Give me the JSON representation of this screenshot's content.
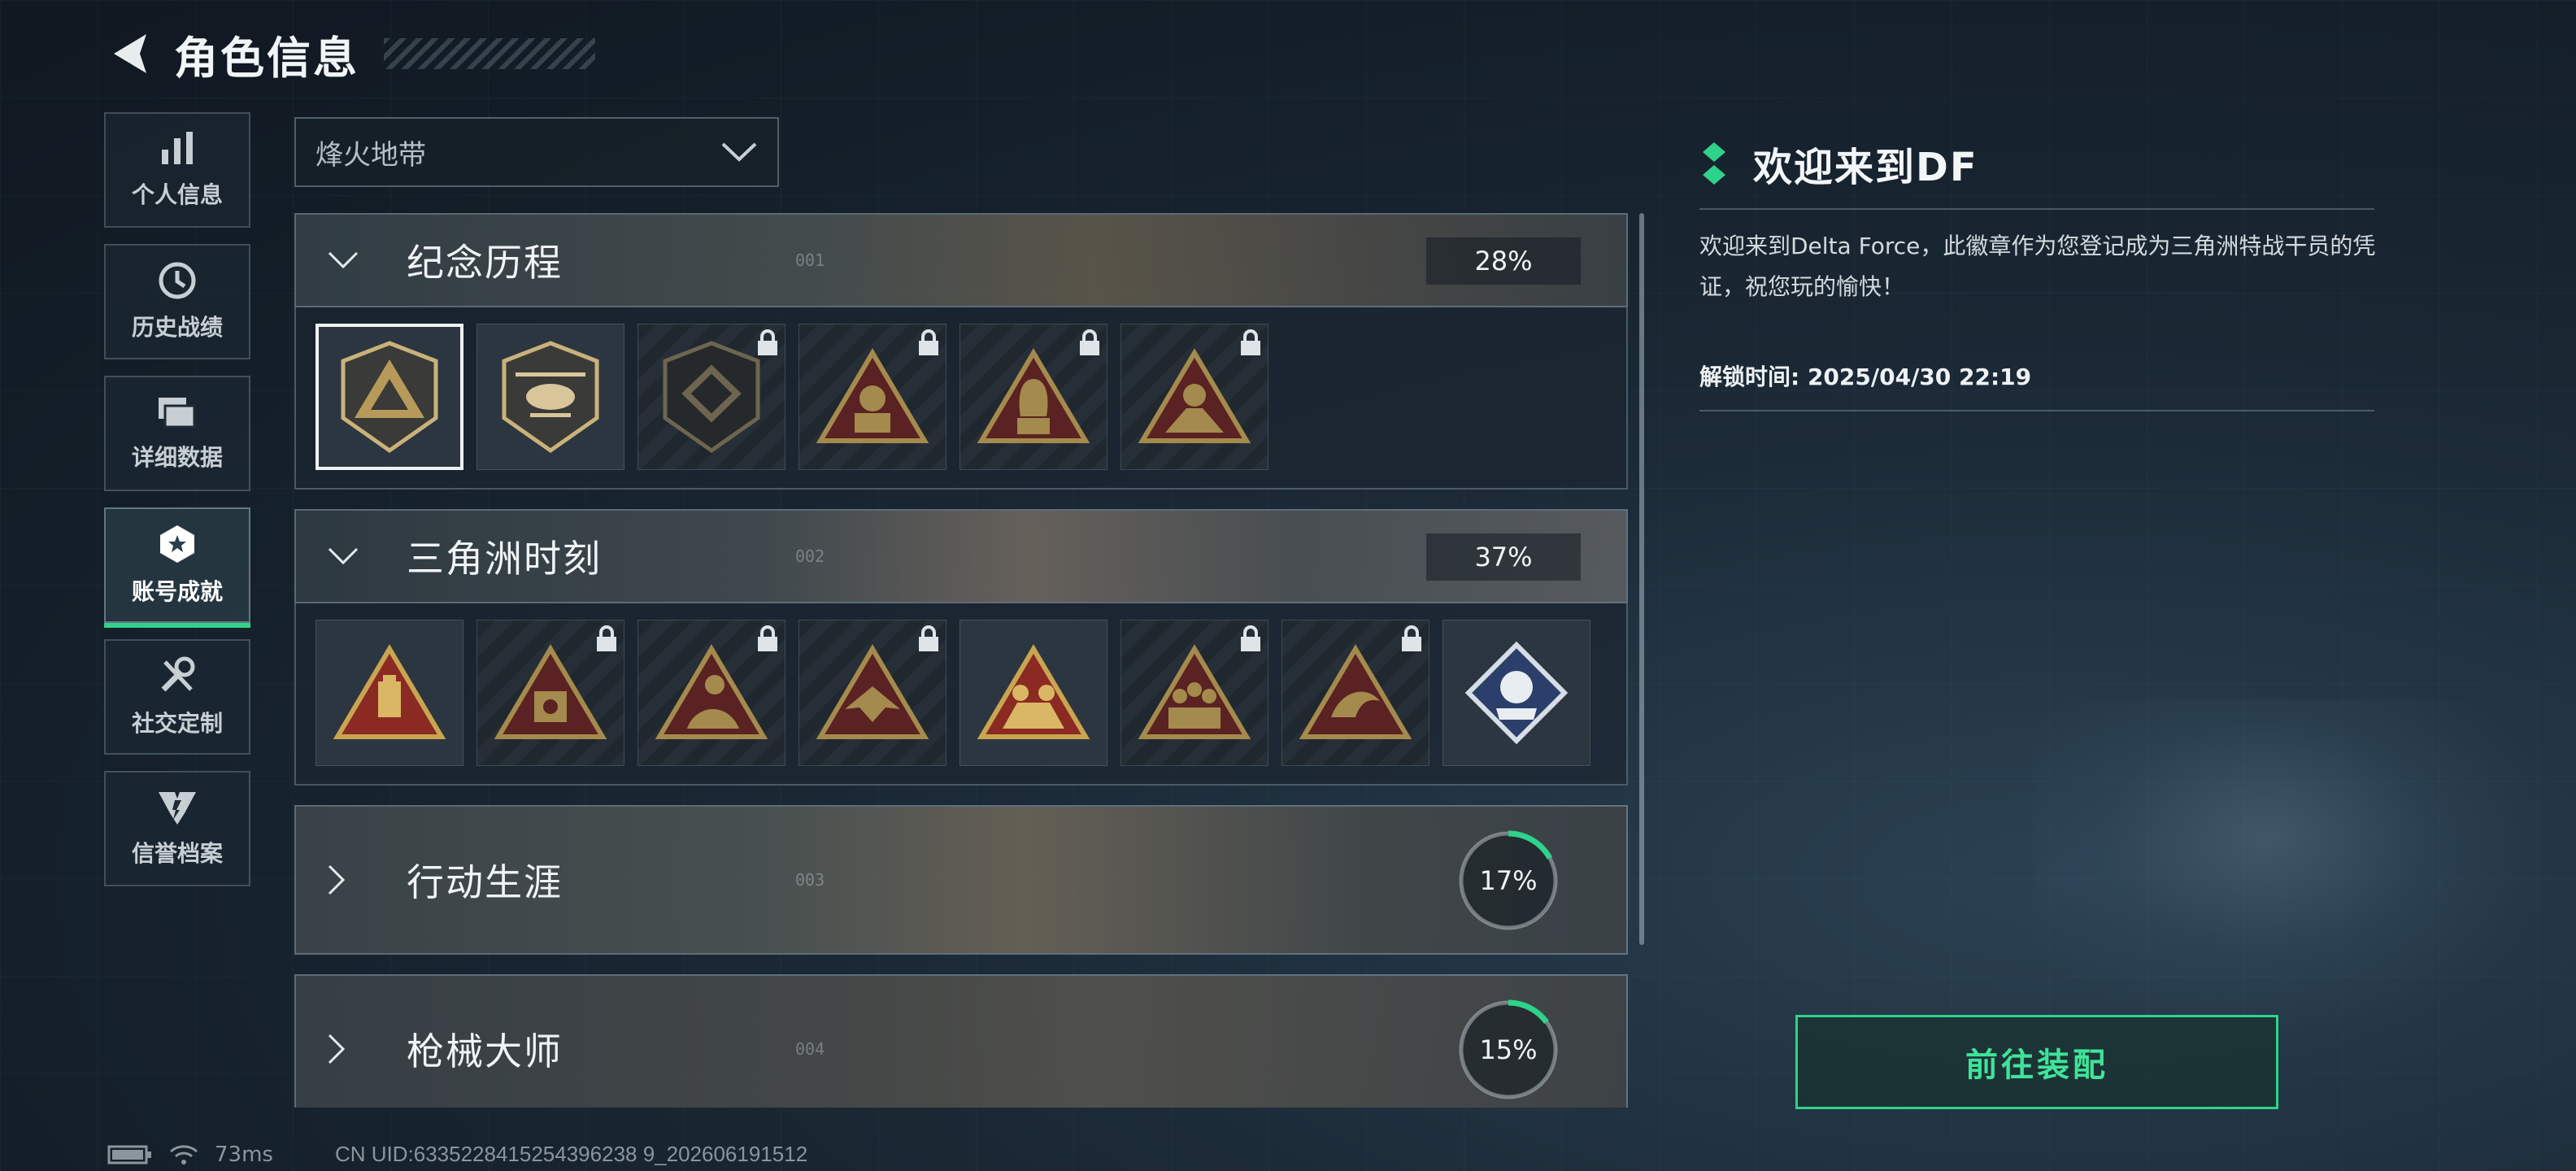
{
  "header": {
    "title": "角色信息"
  },
  "nav": {
    "items": [
      {
        "label": "个人信息",
        "icon": "bar-chart-icon"
      },
      {
        "label": "历史战绩",
        "icon": "history-clock-icon"
      },
      {
        "label": "详细数据",
        "icon": "folder-data-icon"
      },
      {
        "label": "账号成就",
        "icon": "achievement-badge-icon",
        "active": true
      },
      {
        "label": "社交定制",
        "icon": "tools-icon"
      },
      {
        "label": "信誉档案",
        "icon": "reputation-emblem-icon"
      }
    ]
  },
  "mode_select": {
    "value": "烽火地带"
  },
  "categories": [
    {
      "name": "纪念历程",
      "num": "001",
      "percent": "28%",
      "expanded": true,
      "badges": [
        {
          "icon": "delta-shield-badge",
          "locked": false,
          "selected": true
        },
        {
          "icon": "helicopter-shield-badge",
          "locked": false
        },
        {
          "icon": "emblem-shield-badge",
          "locked": true
        },
        {
          "icon": "soldier-triangle-badge",
          "locked": true
        },
        {
          "icon": "hooded-operator-triangle-badge",
          "locked": true
        },
        {
          "icon": "squad-triangle-badge",
          "locked": true
        }
      ]
    },
    {
      "name": "三角洲时刻",
      "num": "002",
      "percent": "37%",
      "expanded": true,
      "badges": [
        {
          "icon": "usb-triangle-badge",
          "locked": false
        },
        {
          "icon": "vault-triangle-badge",
          "locked": true
        },
        {
          "icon": "rider-triangle-badge",
          "locked": true
        },
        {
          "icon": "eagle-triangle-badge",
          "locked": true
        },
        {
          "icon": "team-triangle-badge",
          "locked": false
        },
        {
          "icon": "crowd-triangle-badge",
          "locked": true
        },
        {
          "icon": "dolphin-triangle-badge",
          "locked": true
        },
        {
          "icon": "rose-diamond-badge",
          "locked": false
        }
      ]
    },
    {
      "name": "行动生涯",
      "num": "003",
      "percent": "17%",
      "progress": 0.17,
      "expanded": false
    },
    {
      "name": "枪械大师",
      "num": "004",
      "percent": "15%",
      "progress": 0.15,
      "expanded": false
    }
  ],
  "detail": {
    "title": "欢迎来到DF",
    "description": "欢迎来到Delta Force，此徽章作为您登记成为三角洲特战干员的凭证，祝您玩的愉快！",
    "unlock_text": "解锁时间: 2025/04/30 22:19",
    "button_label": "前往装配"
  },
  "status_bar": {
    "ping": "73ms",
    "uid": "CN UID:6335228415254396238 9_202606191512"
  },
  "colors": {
    "accent": "#2fd28a",
    "gold": "#b8964a"
  }
}
